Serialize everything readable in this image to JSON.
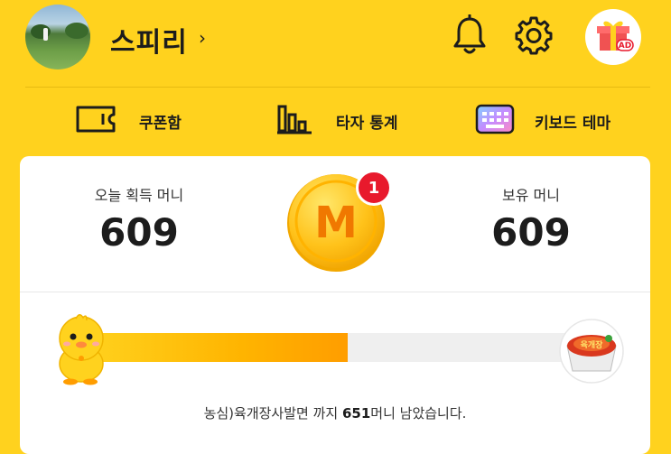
{
  "header": {
    "username": "스피리",
    "chevron": "›",
    "icons": [
      "bell-icon",
      "gear-icon",
      "gift-ad-icon"
    ],
    "gift_badge": "AD"
  },
  "menu": {
    "items": [
      {
        "label": "쿠폰함",
        "icon": "coupon-icon"
      },
      {
        "label": "타자 통계",
        "icon": "bar-chart-icon"
      },
      {
        "label": "키보드 테마",
        "icon": "keyboard-icon"
      }
    ]
  },
  "summary": {
    "today_label": "오늘 획득 머니",
    "today_value": "609",
    "owned_label": "보유 머니",
    "owned_value": "609",
    "coin_letter": "M",
    "notification_count": "1"
  },
  "goal": {
    "progress": 0.52,
    "message_prefix": "농심)육개장사발면 까지 ",
    "remaining": "651",
    "message_suffix": "머니 남았습니다.",
    "bowl_label": "육개장"
  },
  "colors": {
    "background": "#FFD21E",
    "progress": "#FFB400",
    "badge": "#E8192C"
  }
}
